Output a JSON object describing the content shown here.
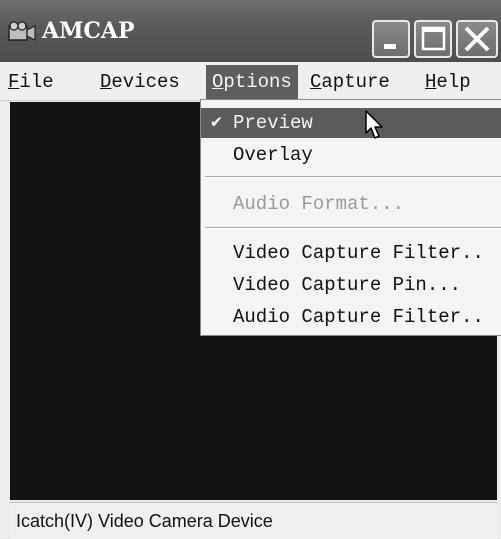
{
  "window": {
    "title": "AMCAP",
    "controls": {
      "minimize": "minimize-icon",
      "maximize": "maximize-icon",
      "close": "close-icon"
    }
  },
  "menubar": {
    "items": [
      {
        "label_u": "F",
        "label_rest": "ile"
      },
      {
        "label_u": "D",
        "label_rest": "evices"
      },
      {
        "label_u": "O",
        "label_rest": "ptions"
      },
      {
        "label_u": "C",
        "label_rest": "apture"
      },
      {
        "label_u": "H",
        "label_rest": "elp"
      }
    ],
    "active": "Options"
  },
  "options_menu": {
    "items": [
      {
        "label": "Preview",
        "checked": true,
        "enabled": true
      },
      {
        "label": "Overlay",
        "checked": false,
        "enabled": true
      },
      {
        "label": "Audio Format...",
        "checked": false,
        "enabled": false
      },
      {
        "label": "Video Capture Filter..",
        "checked": false,
        "enabled": true
      },
      {
        "label": "Video Capture Pin...",
        "checked": false,
        "enabled": true
      },
      {
        "label": "Audio Capture Filter..",
        "checked": false,
        "enabled": true
      }
    ],
    "check_glyph": "✔"
  },
  "statusbar": {
    "text": "Icatch(IV) Video Camera Device"
  },
  "colors": {
    "titlebar": "#5a5a5a",
    "highlight": "#5b5b5b",
    "video_bg": "#121212"
  }
}
